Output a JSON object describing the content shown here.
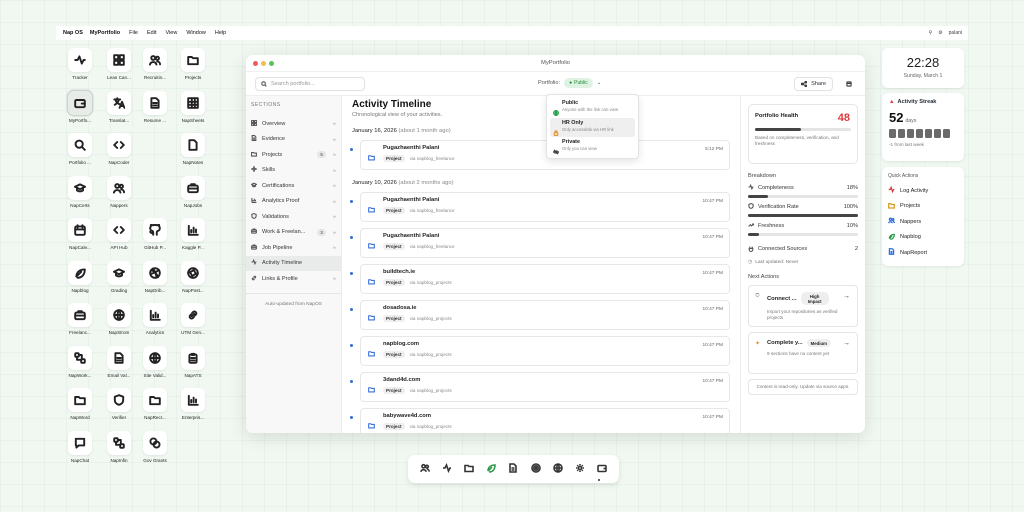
{
  "menubar": {
    "app": "Nap OS",
    "items": [
      "MyPortfolio",
      "File",
      "Edit",
      "View",
      "Window",
      "Help"
    ],
    "user": "palani"
  },
  "desktop_icons": [
    {
      "label": "Tracker",
      "icon": "activity-icon"
    },
    {
      "label": "Lean Can...",
      "icon": "grid-icon"
    },
    {
      "label": "Recruitin...",
      "icon": "users-icon"
    },
    {
      "label": "Projects",
      "icon": "folder-icon"
    },
    {
      "label": "MyPortfo...",
      "icon": "wallet-icon",
      "selected": true
    },
    {
      "label": "Translat...",
      "icon": "translate-icon"
    },
    {
      "label": "Resume ...",
      "icon": "document-icon"
    },
    {
      "label": "NapSheets",
      "icon": "table-icon"
    },
    {
      "label": "Portfolio ...",
      "icon": "search-icon"
    },
    {
      "label": "NapCoder",
      "icon": "code-icon"
    },
    {
      "label": "",
      "icon": ""
    },
    {
      "label": "NapNotes",
      "icon": "note-icon"
    },
    {
      "label": "NapCerts",
      "icon": "graduation-icon"
    },
    {
      "label": "Nappers",
      "icon": "users-icon"
    },
    {
      "label": "",
      "icon": ""
    },
    {
      "label": "NapJobs",
      "icon": "briefcase-icon"
    },
    {
      "label": "NapCale...",
      "icon": "calendar-icon"
    },
    {
      "label": "API Hub",
      "icon": "code-icon"
    },
    {
      "label": "GitHub P...",
      "icon": "github-icon"
    },
    {
      "label": "Kaggle P...",
      "icon": "chart-icon"
    },
    {
      "label": "Napblog",
      "icon": "leaf-icon"
    },
    {
      "label": "Grading",
      "icon": "graduation-icon"
    },
    {
      "label": "NapDrib...",
      "icon": "dribbble-icon"
    },
    {
      "label": "NapPost...",
      "icon": "aperture-icon"
    },
    {
      "label": "Freelanc...",
      "icon": "briefcase-icon"
    },
    {
      "label": "NapStrom",
      "icon": "globe-icon"
    },
    {
      "label": "Analytics",
      "icon": "chart-icon"
    },
    {
      "label": "UTM Gen...",
      "icon": "link-icon"
    },
    {
      "label": "NapWork...",
      "icon": "nodes-icon"
    },
    {
      "label": "Email Val...",
      "icon": "document-icon"
    },
    {
      "label": "Site Valid...",
      "icon": "globe-icon"
    },
    {
      "label": "NapATS",
      "icon": "clipboard-icon"
    },
    {
      "label": "NapWord",
      "icon": "folder-icon"
    },
    {
      "label": "Verifier",
      "icon": "shield-icon"
    },
    {
      "label": "NapRecr...",
      "icon": "folder-icon"
    },
    {
      "label": "Enterpris...",
      "icon": "chart-icon"
    },
    {
      "label": "NapChat",
      "icon": "chat-icon"
    },
    {
      "label": "NapInfin",
      "icon": "nodes-icon"
    },
    {
      "label": "Gov Grants",
      "icon": "coins-icon"
    },
    {
      "label": "",
      "icon": ""
    }
  ],
  "window": {
    "title": "MyPortfolio",
    "search_placeholder": "Search portfolio...",
    "portfolio_label": "Portfolio:",
    "portfolio_value": "Public",
    "share_label": "Share"
  },
  "sidebar": {
    "heading": "SECTIONS",
    "items": [
      {
        "label": "Overview",
        "count": ""
      },
      {
        "label": "Evidence",
        "count": ""
      },
      {
        "label": "Projects",
        "count": "5"
      },
      {
        "label": "Skills",
        "count": ""
      },
      {
        "label": "Certifications",
        "count": ""
      },
      {
        "label": "Analytics Proof",
        "count": ""
      },
      {
        "label": "Validations",
        "count": ""
      },
      {
        "label": "Work & Freelan...",
        "count": "3"
      },
      {
        "label": "Job Pipeline",
        "count": ""
      },
      {
        "label": "Activity Timeline",
        "count": "",
        "active": true
      },
      {
        "label": "Links & Profile",
        "count": ""
      }
    ],
    "footer": "Auto-updated from NapOS"
  },
  "timeline": {
    "title": "Activity Timeline",
    "subtitle": "Chronological view of your activities.",
    "groups": [
      {
        "date": "January 16, 2026",
        "ago": "(about 1 month ago)",
        "items": [
          {
            "name": "Pugazhaenthi Palani",
            "tag": "Project",
            "via": "via napblog_freelance",
            "time": "5:12 PM"
          }
        ]
      },
      {
        "date": "January 10, 2026",
        "ago": "(about 2 months ago)",
        "items": [
          {
            "name": "Pugazhaenthi Palani",
            "tag": "Project",
            "via": "via napblog_freelance",
            "time": "10:47 PM"
          },
          {
            "name": "Pugazhaenthi Palani",
            "tag": "Project",
            "via": "via napblog_freelance",
            "time": "10:47 PM"
          },
          {
            "name": "buildtech.ie",
            "tag": "Project",
            "via": "via napblog_projects",
            "time": "10:47 PM"
          },
          {
            "name": "dosadosa.ie",
            "tag": "Project",
            "via": "via napblog_projects",
            "time": "10:47 PM"
          },
          {
            "name": "napblog.com",
            "tag": "Project",
            "via": "via napblog_projects",
            "time": "10:47 PM"
          },
          {
            "name": "3dand4d.com",
            "tag": "Project",
            "via": "via napblog_projects",
            "time": "10:47 PM"
          },
          {
            "name": "babywave4d.com",
            "tag": "Project",
            "via": "via napblog_projects",
            "time": "10:47 PM"
          }
        ]
      }
    ]
  },
  "dropdown": [
    {
      "title": "Public",
      "sub": "Anyone with the link can view",
      "icon": "globe-icon",
      "color": "#1f9d45"
    },
    {
      "title": "HR Only",
      "sub": "Only accessible via HR link",
      "icon": "lock-icon",
      "color": "#e08f25",
      "selected": true
    },
    {
      "title": "Private",
      "sub": "Only you can view",
      "icon": "eye-off-icon",
      "color": "#333333"
    }
  ],
  "health": {
    "title": "Portfolio Health",
    "score": "48",
    "progress": 0.48,
    "desc": "Based on completeness, verification, and freshness",
    "breakdown_title": "Breakdown",
    "breakdown": [
      {
        "label": "Completeness",
        "value": "18%",
        "fill": 0.18,
        "icon": "activity-icon"
      },
      {
        "label": "Verification Rate",
        "value": "100%",
        "fill": 1.0,
        "icon": "shield-icon"
      },
      {
        "label": "Freshness",
        "value": "10%",
        "fill": 0.1,
        "icon": "trend-icon"
      }
    ],
    "connected_label": "Connected Sources",
    "connected_value": "2",
    "last_updated": "Last updated: Never",
    "next_title": "Next Actions",
    "actions": [
      {
        "title": "Connect ...",
        "badge": "High Impact",
        "desc": "Import your repositories as verified projects",
        "icon": "plug-icon"
      },
      {
        "title": "Complete y...",
        "badge": "Medium",
        "desc": "9 sections have no content yet",
        "icon": "sparkle-icon"
      }
    ],
    "readonly": "Content is read-only. Update via source apps."
  },
  "clock": {
    "time": "22:28",
    "date": "Sunday, March 1"
  },
  "streak": {
    "title": "Activity Streak",
    "days": "52",
    "unit": "days",
    "change": "-1 from last week",
    "accent": "#e23b3b"
  },
  "quick_actions": {
    "title": "Quick Actions",
    "items": [
      {
        "label": "Log Activity",
        "icon": "activity-icon",
        "color": "#d03b3b"
      },
      {
        "label": "Projects",
        "icon": "folder-icon",
        "color": "#d79a22"
      },
      {
        "label": "Nappers",
        "icon": "users-icon",
        "color": "#2f6fdb"
      },
      {
        "label": "Napblog",
        "icon": "leaf-icon",
        "color": "#2d9a4a"
      },
      {
        "label": "NapReport",
        "icon": "document-icon",
        "color": "#2f6fdb"
      }
    ]
  },
  "dock": [
    "users-icon",
    "activity-icon",
    "folder-icon",
    "leaf-icon",
    "document-icon",
    "target-icon",
    "globe-icon",
    "gear-icon",
    "wallet-icon"
  ]
}
